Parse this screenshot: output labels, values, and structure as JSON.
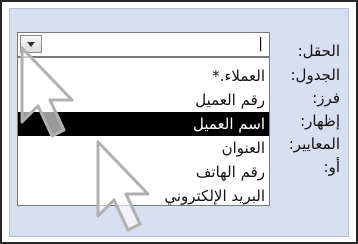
{
  "design_grid": {
    "row_labels": [
      "الحقل:",
      "الجدول:",
      "فرز:",
      "إظهار:",
      "المعايير:",
      "أو:"
    ],
    "field_value": "|"
  },
  "field_dropdown": {
    "icon": "chevron-down-icon",
    "options": [
      "العملاء.*",
      "رقم العميل",
      "اسم العميل",
      "العنوان",
      "رقم الهاتف",
      "البريد الإلكتروني"
    ],
    "selected_option": "اسم العميل"
  },
  "cursors": [
    "arrow-cursor-icon",
    "arrow-cursor-icon"
  ],
  "colors": {
    "panel_bg": "#d6e0ef",
    "selection_bg": "#000000",
    "selection_text": "#ffffff"
  }
}
